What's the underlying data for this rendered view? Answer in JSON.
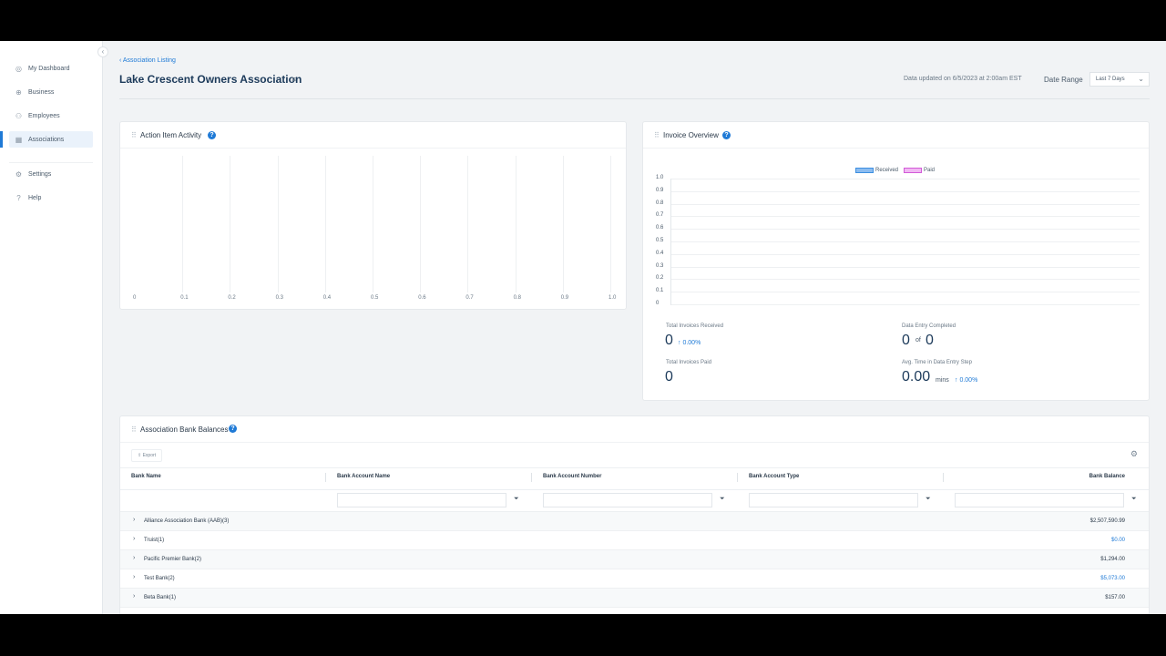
{
  "sidebar": {
    "collapse_icon": "chevron-left-icon",
    "items": [
      {
        "label": "My Dashboard",
        "icon": "dashboard-icon",
        "active": false
      },
      {
        "label": "Business",
        "icon": "globe-icon",
        "active": false
      },
      {
        "label": "Employees",
        "icon": "users-icon",
        "active": false
      },
      {
        "label": "Associations",
        "icon": "building-icon",
        "active": true
      },
      {
        "label": "Settings",
        "icon": "gear-icon",
        "active": false
      },
      {
        "label": "Help",
        "icon": "help-icon",
        "active": false
      }
    ]
  },
  "header": {
    "breadcrumb": "Association Listing",
    "title": "Lake Crescent Owners Association",
    "updated": "Data updated on 6/5/2023 at 2:00am EST",
    "range_label": "Date Range",
    "range_value": "Last 7 Days"
  },
  "action_card": {
    "title": "Action Item Activity",
    "x_ticks": [
      "0",
      "0.1",
      "0.2",
      "0.3",
      "0.4",
      "0.5",
      "0.6",
      "0.7",
      "0.8",
      "0.9",
      "1.0"
    ]
  },
  "invoice_card": {
    "title": "Invoice Overview",
    "legend": [
      "Received",
      "Paid"
    ],
    "y_ticks": [
      "1.0",
      "0.9",
      "0.8",
      "0.7",
      "0.6",
      "0.5",
      "0.4",
      "0.3",
      "0.2",
      "0.1",
      "0"
    ],
    "stats": {
      "received_label": "Total Invoices Received",
      "received_value": "0",
      "received_change": "↑ 0.00%",
      "paid_label": "Total Invoices Paid",
      "paid_value": "0",
      "entry_label": "Data Entry Completed",
      "entry_value": "0",
      "entry_of": "of",
      "entry_total": "0",
      "avg_label": "Avg. Time in Data Entry Step",
      "avg_value": "0.00",
      "avg_unit": "mins",
      "avg_change": "↑ 0.00%"
    }
  },
  "bank_card": {
    "title": "Association Bank Balances",
    "export_label": "Export",
    "columns": [
      "Bank Name",
      "Bank Account Name",
      "Bank Account Number",
      "Bank Account Type",
      "Bank Balance"
    ],
    "rows": [
      {
        "name": "Alliance Association Bank (AAB)(3)",
        "balance": "$2,507,590.99",
        "link": false
      },
      {
        "name": "Truist(1)",
        "balance": "$0.00",
        "link": true
      },
      {
        "name": "Pacific Premier Bank(2)",
        "balance": "$1,294.00",
        "link": false
      },
      {
        "name": "Test Bank(2)",
        "balance": "$5,073.00",
        "link": true
      },
      {
        "name": "Beta Bank(1)",
        "balance": "$157.00",
        "link": false
      }
    ]
  },
  "chart_data": [
    {
      "type": "bar",
      "title": "Action Item Activity",
      "x_ticks": [
        0,
        0.1,
        0.2,
        0.3,
        0.4,
        0.5,
        0.6,
        0.7,
        0.8,
        0.9,
        1.0
      ],
      "xlim": [
        0,
        1
      ],
      "series": [],
      "grid": true
    },
    {
      "type": "bar",
      "title": "Invoice Overview",
      "ylim": [
        0,
        1
      ],
      "y_ticks": [
        0,
        0.1,
        0.2,
        0.3,
        0.4,
        0.5,
        0.6,
        0.7,
        0.8,
        0.9,
        1.0
      ],
      "series": [
        {
          "name": "Received",
          "values": [],
          "color": "#3d8fe0"
        },
        {
          "name": "Paid",
          "values": [],
          "color": "#d25ad8"
        }
      ],
      "legend_position": "top-center",
      "grid": true
    }
  ]
}
